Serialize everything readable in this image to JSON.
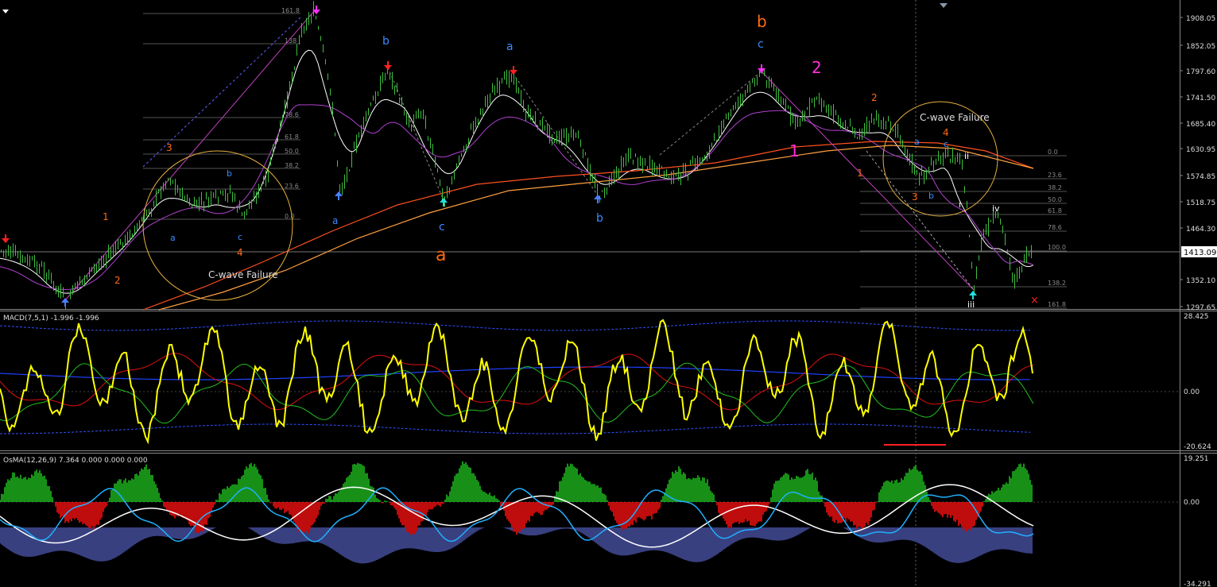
{
  "main": {
    "price_levels": [
      "1908.05",
      "1852.05",
      "1797.60",
      "1741.50",
      "1685.40",
      "1630.95",
      "1574.85",
      "1518.75",
      "1464.30",
      "1413.09",
      "1352.10",
      "1297.65"
    ],
    "current_price": "1413.09",
    "wave_labels": [
      {
        "text": "1",
        "color": "#ff6a13"
      },
      {
        "text": "2",
        "color": "#ff6a13"
      },
      {
        "text": "3",
        "color": "#ff6a13"
      },
      {
        "text": "4",
        "color": "#ff6a13"
      },
      {
        "text": "a",
        "color": "#3b8bff"
      },
      {
        "text": "b",
        "color": "#3b8bff"
      },
      {
        "text": "c",
        "color": "#3b8bff"
      },
      {
        "text": "a",
        "color": "#3b8bff"
      },
      {
        "text": "b",
        "color": "#3b8bff"
      },
      {
        "text": "c",
        "color": "#3b8bff"
      },
      {
        "text": "a",
        "color": "#ff6a13"
      },
      {
        "text": "a",
        "color": "#3b8bff"
      },
      {
        "text": "b",
        "color": "#3b8bff"
      },
      {
        "text": "b",
        "color": "#ff6a13"
      },
      {
        "text": "c",
        "color": "#3b8bff"
      },
      {
        "text": "2",
        "color": "#ff2fd6"
      },
      {
        "text": "1",
        "color": "#ff2fd6"
      },
      {
        "text": "1",
        "color": "#ff6a13"
      },
      {
        "text": "2",
        "color": "#ff6a13"
      },
      {
        "text": "3",
        "color": "#ff6a13"
      },
      {
        "text": "4",
        "color": "#ff6a13"
      },
      {
        "text": "a",
        "color": "#3b8bff"
      },
      {
        "text": "b",
        "color": "#3b8bff"
      },
      {
        "text": "c",
        "color": "#3b8bff"
      },
      {
        "text": "i",
        "color": "#ffffff"
      },
      {
        "text": "ii",
        "color": "#ffffff"
      },
      {
        "text": "iii",
        "color": "#ffffff"
      },
      {
        "text": "iv",
        "color": "#ffffff"
      }
    ],
    "annotations": [
      "C-wave Failure",
      "C-wave Failure"
    ],
    "fib_left": [
      "161.8",
      "138",
      "78.6",
      "61.8",
      "50.0",
      "38.2",
      "23.6",
      "0.0"
    ],
    "fib_right": [
      "0.0",
      "23.6",
      "38.2",
      "50.0",
      "61.8",
      "78.6",
      "100.0",
      "138.2",
      "161.8"
    ]
  },
  "macd": {
    "title": "MACD(7,5,1) -1.996 -1.996",
    "levels": [
      "28.425",
      "0.00",
      "-20.624"
    ]
  },
  "osma": {
    "title": "OsMA(12,26,9) 7.364 0.000 0.000 0.000",
    "levels": [
      "19.251",
      "0.00",
      "-34.291"
    ]
  },
  "colors": {
    "candles": "#3fbf3f",
    "ma_white": "#ffffff",
    "ma_magenta": "#b040d0",
    "ma_orange1": "#ff5020",
    "ma_orange2": "#ffa040",
    "macd_main": "#ffff00",
    "macd_red": "#e01010",
    "macd_green": "#20c020",
    "macd_blue": "#2040ff",
    "osma_green": "#20c020",
    "osma_red": "#ff1010",
    "osma_blue": "#7080ff",
    "osma_cyan": "#20b0ff"
  }
}
